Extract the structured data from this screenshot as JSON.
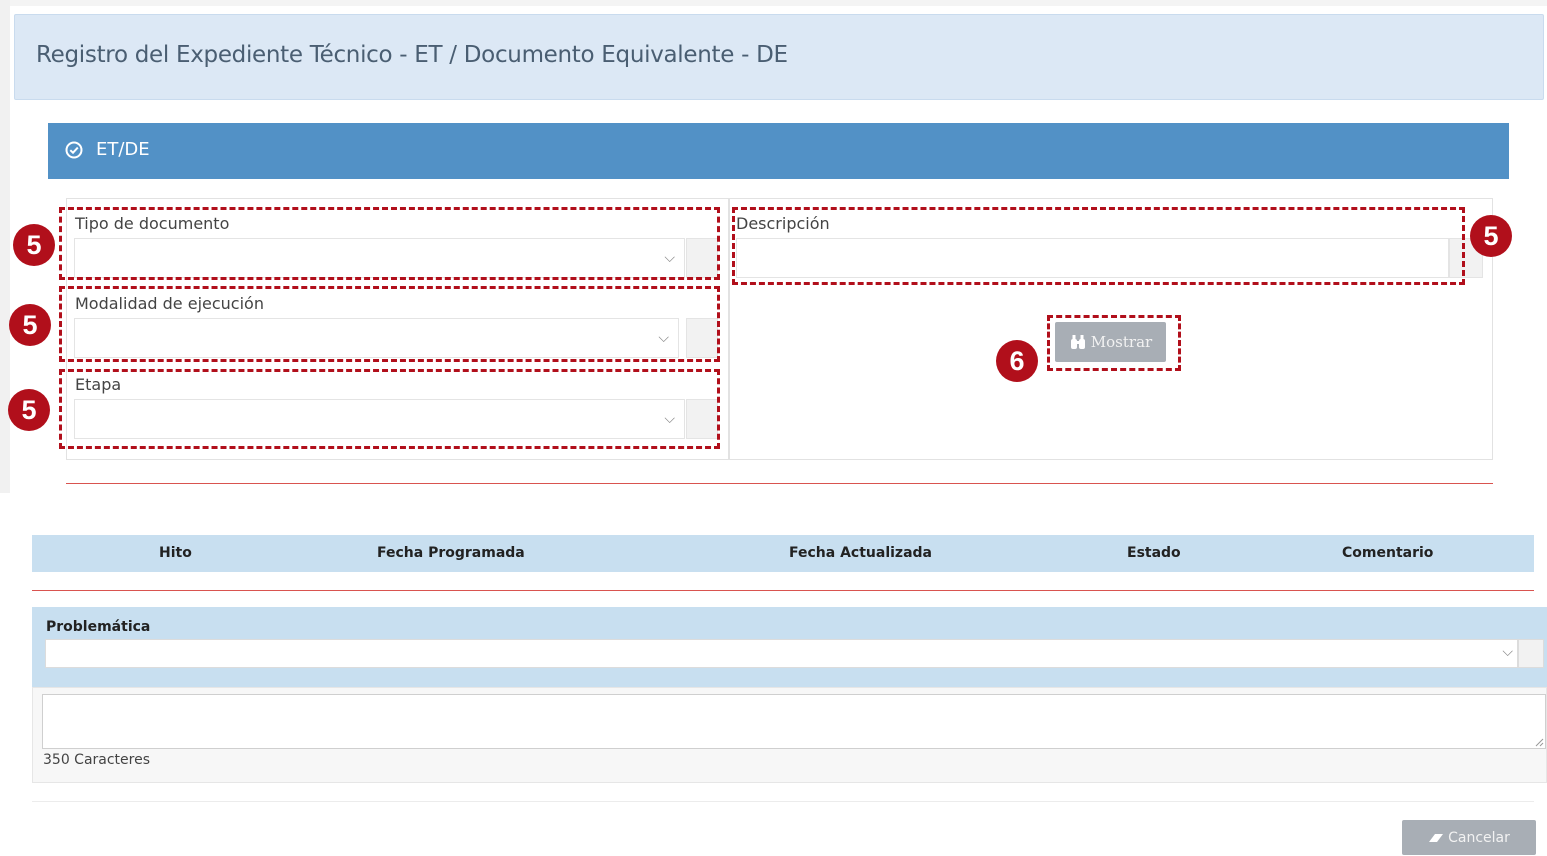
{
  "header": {
    "title": "Registro del Expediente Técnico - ET / Documento Equivalente - DE"
  },
  "section": {
    "label": "ET/DE",
    "icon": "check-circle-icon"
  },
  "form": {
    "tipo_documento": {
      "label": "Tipo de documento",
      "value": ""
    },
    "modalidad": {
      "label": "Modalidad de ejecución",
      "value": ""
    },
    "etapa": {
      "label": "Etapa",
      "value": ""
    },
    "descripcion": {
      "label": "Descripción",
      "value": ""
    },
    "mostrar_label": "Mostrar"
  },
  "annotations": {
    "badge_5": "5",
    "badge_6": "6"
  },
  "table": {
    "columns": [
      "Hito",
      "Fecha Programada",
      "Fecha Actualizada",
      "Estado",
      "Comentario"
    ]
  },
  "problematica": {
    "label": "Problemática",
    "value": "",
    "char_count": "350 Caracteres"
  },
  "footer": {
    "cancel_label": "Cancelar"
  },
  "colors": {
    "accent": "#5291c6",
    "annotation": "#b10f1b",
    "header_bg": "#dce8f5"
  }
}
